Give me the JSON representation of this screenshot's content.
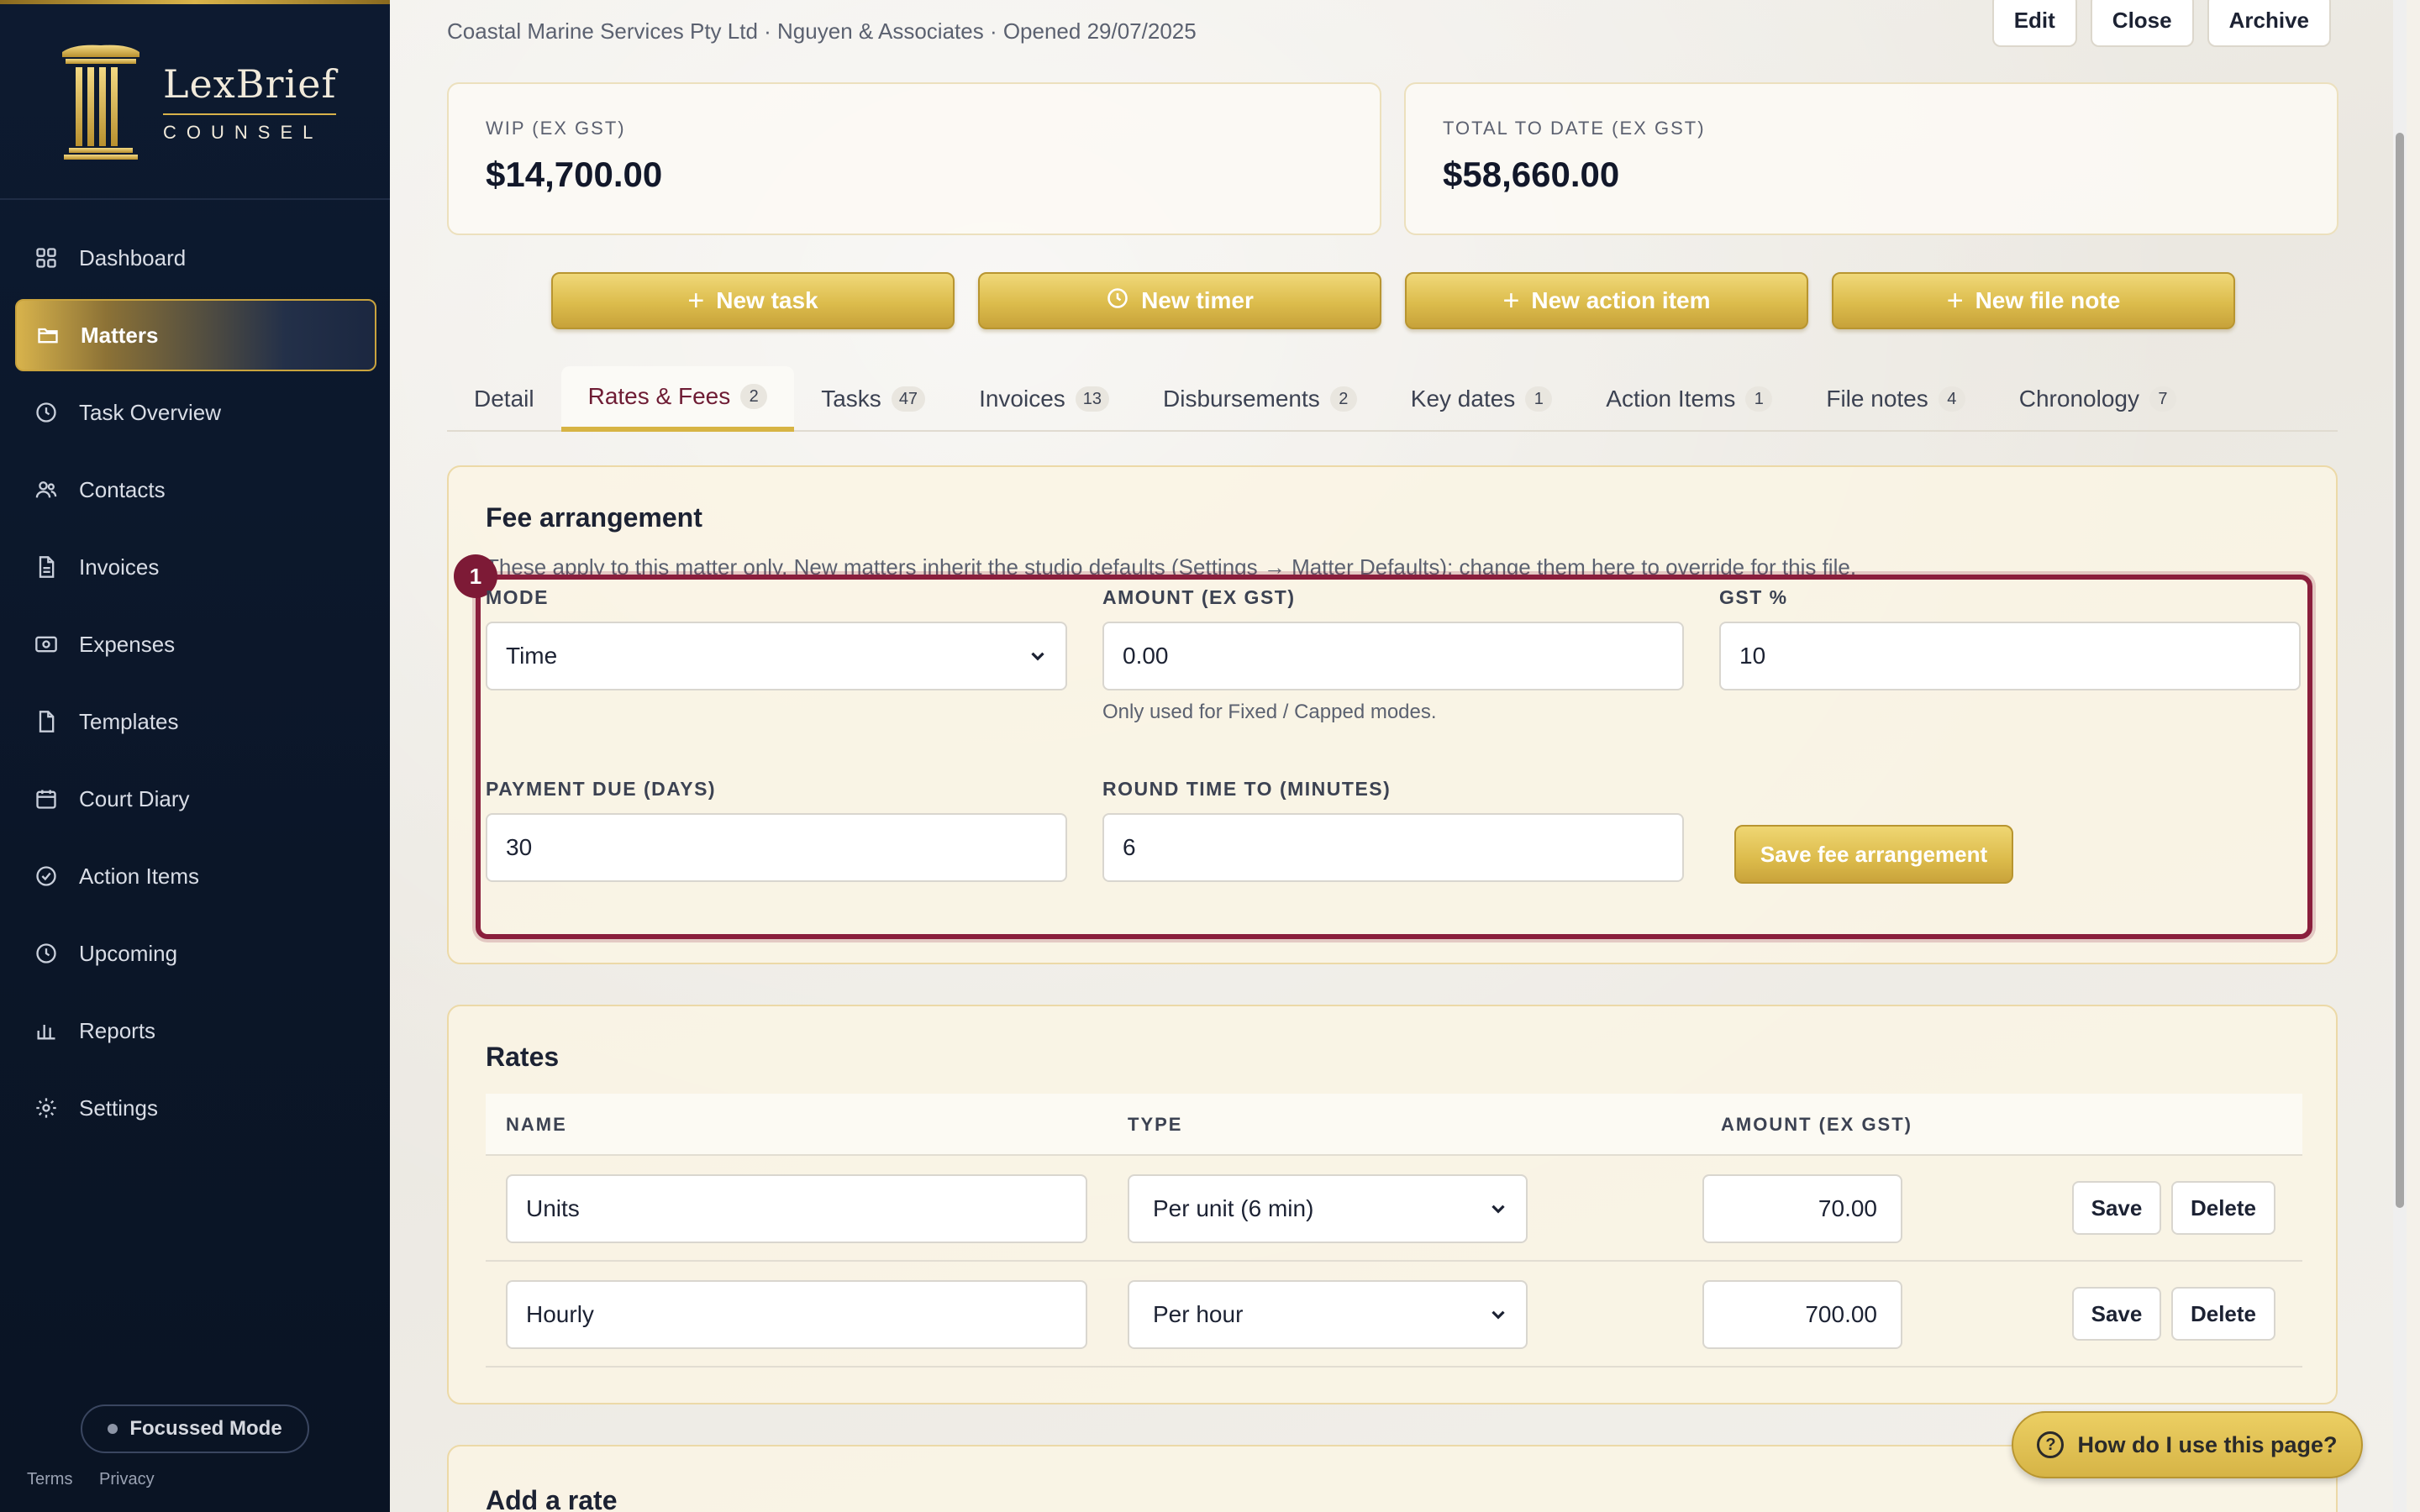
{
  "brand": {
    "name": "LexBrief",
    "sub": "COUNSEL"
  },
  "sidebar": {
    "items": [
      {
        "label": "Dashboard",
        "icon": "grid-icon"
      },
      {
        "label": "Matters",
        "icon": "folder-icon",
        "active": true
      },
      {
        "label": "Task Overview",
        "icon": "clock-icon"
      },
      {
        "label": "Contacts",
        "icon": "users-icon"
      },
      {
        "label": "Invoices",
        "icon": "document-icon"
      },
      {
        "label": "Expenses",
        "icon": "banknote-icon"
      },
      {
        "label": "Templates",
        "icon": "file-icon"
      },
      {
        "label": "Court Diary",
        "icon": "calendar-icon"
      },
      {
        "label": "Action Items",
        "icon": "check-circle-icon"
      },
      {
        "label": "Upcoming",
        "icon": "clock-icon"
      },
      {
        "label": "Reports",
        "icon": "bar-chart-icon"
      },
      {
        "label": "Settings",
        "icon": "gear-icon"
      }
    ],
    "focus_mode": "Focussed Mode",
    "terms": "Terms",
    "privacy": "Privacy"
  },
  "header": {
    "subtitle": "Coastal Marine Services Pty Ltd · Nguyen & Associates · Opened 29/07/2025",
    "edit": "Edit",
    "close": "Close",
    "archive": "Archive"
  },
  "stats": {
    "wip_label": "WIP (EX GST)",
    "wip_value": "$14,700.00",
    "total_label": "TOTAL TO DATE (EX GST)",
    "total_value": "$58,660.00"
  },
  "actions": {
    "new_task": "New task",
    "new_timer": "New timer",
    "new_action_item": "New action item",
    "new_file_note": "New file note"
  },
  "tabs": [
    {
      "label": "Detail",
      "count": ""
    },
    {
      "label": "Rates & Fees",
      "count": "2",
      "active": true
    },
    {
      "label": "Tasks",
      "count": "47"
    },
    {
      "label": "Invoices",
      "count": "13"
    },
    {
      "label": "Disbursements",
      "count": "2"
    },
    {
      "label": "Key dates",
      "count": "1"
    },
    {
      "label": "Action Items",
      "count": "1"
    },
    {
      "label": "File notes",
      "count": "4"
    },
    {
      "label": "Chronology",
      "count": "7"
    }
  ],
  "fee": {
    "title": "Fee arrangement",
    "note": "These apply to this matter only. New matters inherit the studio defaults (Settings → Matter Defaults); change them here to override for this file.",
    "highlight_number": "1",
    "mode_label": "MODE",
    "mode_value": "Time",
    "amount_label": "AMOUNT (EX GST)",
    "amount_value": "0.00",
    "amount_help": "Only used for Fixed / Capped modes.",
    "gst_label": "GST %",
    "gst_value": "10",
    "due_label": "PAYMENT DUE (DAYS)",
    "due_value": "30",
    "round_label": "ROUND TIME TO (MINUTES)",
    "round_value": "6",
    "save": "Save fee arrangement"
  },
  "rates": {
    "title": "Rates",
    "col_name": "NAME",
    "col_type": "TYPE",
    "col_amount": "AMOUNT (EX GST)",
    "rows": [
      {
        "name": "Units",
        "type": "Per unit (6 min)",
        "amount": "70.00"
      },
      {
        "name": "Hourly",
        "type": "Per hour",
        "amount": "700.00"
      }
    ],
    "save": "Save",
    "delete": "Delete"
  },
  "add_rate": {
    "title": "Add a rate"
  },
  "help": {
    "label": "How do I use this page?"
  },
  "colors": {
    "gold": "#d8b444",
    "navy": "#0c182c",
    "maroon": "#7d1a36"
  }
}
